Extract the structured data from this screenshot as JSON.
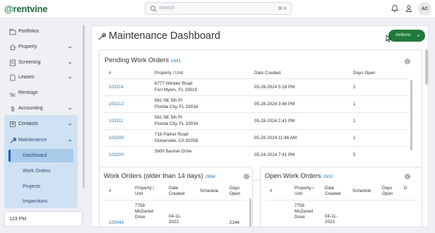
{
  "app": {
    "logo_text": "rentvine"
  },
  "search": {
    "placeholder": "Search",
    "shortcut": "⌘ K"
  },
  "user": {
    "initials": "AC"
  },
  "sidebar": {
    "items": [
      {
        "label": "Portfolios",
        "icon": "portfolio-icon"
      },
      {
        "label": "Property",
        "icon": "home-icon"
      },
      {
        "label": "Screening",
        "icon": "screening-icon"
      },
      {
        "label": "Leases",
        "icon": "lease-icon"
      },
      {
        "label": "Rentsign",
        "icon": "signature-icon"
      },
      {
        "label": "Accounting",
        "icon": "dollar-icon"
      },
      {
        "label": "Contacts",
        "icon": "contacts-icon"
      },
      {
        "label": "Maintenance",
        "icon": "wrench-icon"
      }
    ],
    "maintenance_sub": [
      "Dashboard",
      "Work Orders",
      "Projects",
      "Inspections"
    ],
    "time": "123 PM"
  },
  "page": {
    "title": "Maintenance Dashboard",
    "actions_label": "Actions"
  },
  "pending": {
    "title": "Pending Work Orders",
    "count": "1441",
    "headers": [
      "#",
      "Property / Unit",
      "Date Created",
      "Days Open"
    ],
    "rows": [
      {
        "id": "103214",
        "addr1": "6777 Winkler Road",
        "addr2": "Fort Myers, FL 33919",
        "date": "05-28-2024 5:28 PM",
        "days": "1"
      },
      {
        "id": "103212",
        "addr1": "561 NE 5th Pl",
        "addr2": "Florida City, FL 33034",
        "date": "05-28-2024 3:46 PM",
        "days": "1"
      },
      {
        "id": "103211",
        "addr1": "561 NE 5th Pl",
        "addr2": "Florida City, FL 33034",
        "date": "05-28-2024 2:41 PM",
        "days": "1"
      },
      {
        "id": "103209",
        "addr1": "718 Parker Road",
        "addr2": "Oceanside, CA 92058",
        "date": "05-28-2024 11:46 AM",
        "days": "1"
      },
      {
        "id": "103200",
        "addr1": "5600 Banner Drive",
        "addr2": "",
        "date": "05-24-2024 7:41 PM",
        "days": "5"
      }
    ]
  },
  "older": {
    "title": "Work Orders (older than 14 days)",
    "count": "2884",
    "headers": [
      "#",
      "Property / Unit",
      "Date Created",
      "Schedule",
      "Days Open"
    ],
    "row": {
      "id": "100044",
      "addr": "7758 McDaniel Drive",
      "date": "04-11-2023",
      "days": "2144"
    }
  },
  "open": {
    "title": "Open Work Orders",
    "count": "1502",
    "headers": [
      "#",
      "Property / Unit",
      "Date Created",
      "Schedule",
      "Days Open",
      "D"
    ],
    "row": {
      "addr": "7758 McDaniel Drive",
      "date": "04-11-2023"
    }
  },
  "colors": {
    "accent": "#1f7a3a",
    "link": "#2a7ab8",
    "active_nav": "#cfe2f3"
  }
}
